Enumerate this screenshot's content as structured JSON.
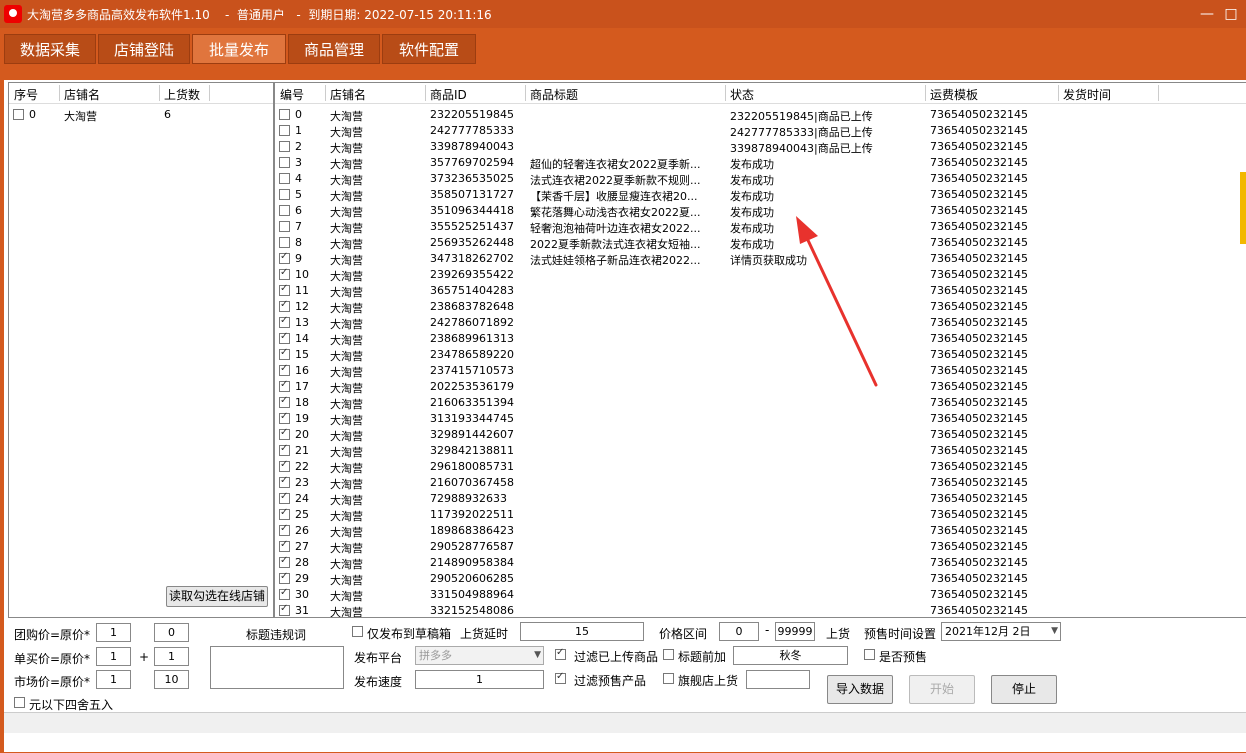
{
  "titlebar": {
    "text": "大淘营多多商品高效发布软件1.10    -  普通用户   -  到期日期: 2022-07-15 20:11:16"
  },
  "tabs": [
    "数据采集",
    "店铺登陆",
    "批量发布",
    "商品管理",
    "软件配置"
  ],
  "left_table": {
    "headers": [
      "序号",
      "店铺名",
      "上货数"
    ],
    "rows": [
      {
        "index": "0",
        "shop": "大淘营",
        "count": "6",
        "checked": false
      }
    ],
    "read_button": "读取勾选在线店铺"
  },
  "right_table": {
    "headers": [
      "编号",
      "店铺名",
      "商品ID",
      "商品标题",
      "状态",
      "运费模板",
      "发货时间"
    ],
    "rows": [
      {
        "n": "0",
        "shop": "大淘营",
        "id": "232205519845",
        "title": "",
        "status": "232205519845|商品已上传",
        "tpl": "73654050232145",
        "c": false
      },
      {
        "n": "1",
        "shop": "大淘营",
        "id": "242777785333",
        "title": "",
        "status": "242777785333|商品已上传",
        "tpl": "73654050232145",
        "c": false
      },
      {
        "n": "2",
        "shop": "大淘营",
        "id": "339878940043",
        "title": "",
        "status": "339878940043|商品已上传",
        "tpl": "73654050232145",
        "c": false
      },
      {
        "n": "3",
        "shop": "大淘营",
        "id": "357769702594",
        "title": "超仙的轻奢连衣裙女2022夏季新...",
        "status": "发布成功",
        "tpl": "73654050232145",
        "c": false
      },
      {
        "n": "4",
        "shop": "大淘营",
        "id": "373236535025",
        "title": "法式连衣裙2022夏季新款不规则...",
        "status": "发布成功",
        "tpl": "73654050232145",
        "c": false
      },
      {
        "n": "5",
        "shop": "大淘营",
        "id": "358507131727",
        "title": "【茉香千层】收腰显瘦连衣裙20...",
        "status": "发布成功",
        "tpl": "73654050232145",
        "c": false
      },
      {
        "n": "6",
        "shop": "大淘营",
        "id": "351096344418",
        "title": "繁花落舞心动浅杏衣裙女2022夏...",
        "status": "发布成功",
        "tpl": "73654050232145",
        "c": false
      },
      {
        "n": "7",
        "shop": "大淘营",
        "id": "355525251437",
        "title": "轻奢泡泡袖荷叶边连衣裙女2022...",
        "status": "发布成功",
        "tpl": "73654050232145",
        "c": false
      },
      {
        "n": "8",
        "shop": "大淘营",
        "id": "256935262448",
        "title": "2022夏季新款法式连衣裙女短袖...",
        "status": "发布成功",
        "tpl": "73654050232145",
        "c": false
      },
      {
        "n": "9",
        "shop": "大淘营",
        "id": "347318262702",
        "title": "法式娃娃领格子新品连衣裙2022...",
        "status": "详情页获取成功",
        "tpl": "73654050232145",
        "c": true
      },
      {
        "n": "10",
        "shop": "大淘营",
        "id": "239269355422",
        "title": "",
        "status": "",
        "tpl": "73654050232145",
        "c": true
      },
      {
        "n": "11",
        "shop": "大淘营",
        "id": "365751404283",
        "title": "",
        "status": "",
        "tpl": "73654050232145",
        "c": true
      },
      {
        "n": "12",
        "shop": "大淘营",
        "id": "238683782648",
        "title": "",
        "status": "",
        "tpl": "73654050232145",
        "c": true
      },
      {
        "n": "13",
        "shop": "大淘营",
        "id": "242786071892",
        "title": "",
        "status": "",
        "tpl": "73654050232145",
        "c": true
      },
      {
        "n": "14",
        "shop": "大淘营",
        "id": "238689961313",
        "title": "",
        "status": "",
        "tpl": "73654050232145",
        "c": true
      },
      {
        "n": "15",
        "shop": "大淘营",
        "id": "234786589220",
        "title": "",
        "status": "",
        "tpl": "73654050232145",
        "c": true
      },
      {
        "n": "16",
        "shop": "大淘营",
        "id": "237415710573",
        "title": "",
        "status": "",
        "tpl": "73654050232145",
        "c": true
      },
      {
        "n": "17",
        "shop": "大淘营",
        "id": "202253536179",
        "title": "",
        "status": "",
        "tpl": "73654050232145",
        "c": true
      },
      {
        "n": "18",
        "shop": "大淘营",
        "id": "216063351394",
        "title": "",
        "status": "",
        "tpl": "73654050232145",
        "c": true
      },
      {
        "n": "19",
        "shop": "大淘营",
        "id": "313193344745",
        "title": "",
        "status": "",
        "tpl": "73654050232145",
        "c": true
      },
      {
        "n": "20",
        "shop": "大淘营",
        "id": "329891442607",
        "title": "",
        "status": "",
        "tpl": "73654050232145",
        "c": true
      },
      {
        "n": "21",
        "shop": "大淘营",
        "id": "329842138811",
        "title": "",
        "status": "",
        "tpl": "73654050232145",
        "c": true
      },
      {
        "n": "22",
        "shop": "大淘营",
        "id": "296180085731",
        "title": "",
        "status": "",
        "tpl": "73654050232145",
        "c": true
      },
      {
        "n": "23",
        "shop": "大淘营",
        "id": "216070367458",
        "title": "",
        "status": "",
        "tpl": "73654050232145",
        "c": true
      },
      {
        "n": "24",
        "shop": "大淘营",
        "id": "72988932633",
        "title": "",
        "status": "",
        "tpl": "73654050232145",
        "c": true
      },
      {
        "n": "25",
        "shop": "大淘营",
        "id": "117392022511",
        "title": "",
        "status": "",
        "tpl": "73654050232145",
        "c": true
      },
      {
        "n": "26",
        "shop": "大淘营",
        "id": "189868386423",
        "title": "",
        "status": "",
        "tpl": "73654050232145",
        "c": true
      },
      {
        "n": "27",
        "shop": "大淘营",
        "id": "290528776587",
        "title": "",
        "status": "",
        "tpl": "73654050232145",
        "c": true
      },
      {
        "n": "28",
        "shop": "大淘营",
        "id": "214890958384",
        "title": "",
        "status": "",
        "tpl": "73654050232145",
        "c": true
      },
      {
        "n": "29",
        "shop": "大淘营",
        "id": "290520606285",
        "title": "",
        "status": "",
        "tpl": "73654050232145",
        "c": true
      },
      {
        "n": "30",
        "shop": "大淘营",
        "id": "331504988964",
        "title": "",
        "status": "",
        "tpl": "73654050232145",
        "c": true
      },
      {
        "n": "31",
        "shop": "大淘营",
        "id": "332152548086",
        "title": "",
        "status": "",
        "tpl": "73654050232145",
        "c": true
      }
    ]
  },
  "controls": {
    "group_price_label": "团购价=原价*",
    "group_mult": "1",
    "group_add": "0",
    "single_price_label": "单买价=原价*",
    "single_mult": "1",
    "plus": "+",
    "single_add": "1",
    "market_price_label": "市场价=原价*",
    "market_mult": "1",
    "market_add": "10",
    "round_label": "元以下四舍五入",
    "title_rule_label": "标题违规词",
    "draft_label": "仅发布到草稿箱",
    "delay_label": "上货延时",
    "delay_value": "15",
    "price_range_label": "价格区间",
    "price_min": "0",
    "dash": "-",
    "price_max": "99999",
    "shelf_label": "上货",
    "presale_time_label": "预售时间设置",
    "presale_date": "2021年12月 2日",
    "platform_label": "发布平台",
    "platform_value": "拼多多",
    "filter_uploaded_label": "过滤已上传商品",
    "title_prefix_label": "标题前加",
    "title_prefix_value": "秋冬",
    "presale_label": "是否预售",
    "speed_label": "发布速度",
    "speed_value": "1",
    "filter_presale_label": "过滤预售产品",
    "flagship_label": "旗舰店上货",
    "import_button": "导入数据",
    "start_button": "开始",
    "stop_button": "停止"
  }
}
